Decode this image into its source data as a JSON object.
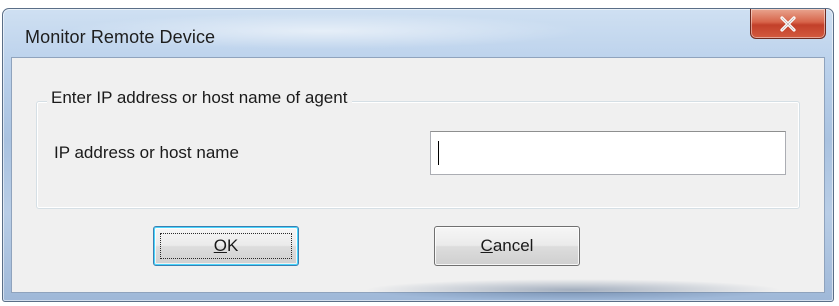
{
  "window": {
    "title": "Monitor Remote Device",
    "close_glyph": "X",
    "close_icon": "close-x-icon"
  },
  "group": {
    "legend": "Enter IP address or host name of agent"
  },
  "form": {
    "host_label": "IP address or host name",
    "host_value": ""
  },
  "buttons": {
    "ok_mnemonic": "O",
    "ok_rest": "K",
    "cancel_mnemonic": "C",
    "cancel_rest": "ancel"
  },
  "colors": {
    "close_button": "#c9462d",
    "dialog_background": "#f0f0f0",
    "default_button_border": "#3c7fb1"
  }
}
